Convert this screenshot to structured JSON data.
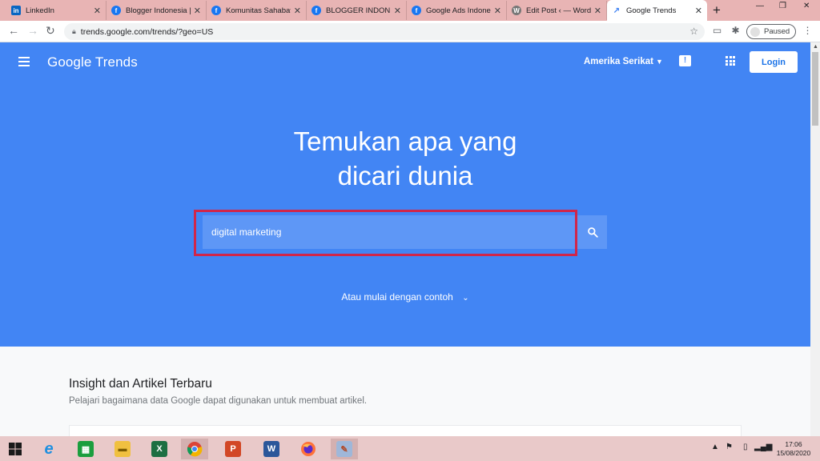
{
  "browser": {
    "tabs": [
      {
        "title": "LinkedIn",
        "favicon": "linkedin-icon"
      },
      {
        "title": "Blogger Indonesia |",
        "favicon": "facebook-icon"
      },
      {
        "title": "Komunitas Sahabat",
        "favicon": "facebook-icon"
      },
      {
        "title": "BLOGGER INDONE",
        "favicon": "facebook-icon"
      },
      {
        "title": "Google Ads Indone",
        "favicon": "facebook-icon"
      },
      {
        "title": "Edit Post ‹ — Word",
        "favicon": "wordpress-icon"
      },
      {
        "title": "Google Trends",
        "favicon": "trends-icon",
        "active": true
      }
    ],
    "url": "trends.google.com/trends/?geo=US",
    "profile_status": "Paused"
  },
  "header": {
    "logo": "Google Trends",
    "region": "Amerika Serikat",
    "login_label": "Login"
  },
  "hero": {
    "headline_line1": "Temukan apa yang",
    "headline_line2": "dicari dunia",
    "search_value": "digital marketing",
    "examples_label": "Atau mulai dengan contoh"
  },
  "insight": {
    "title": "Insight dan Artikel Terbaru",
    "subtitle": "Pelajari bagaimana data Google dapat digunakan untuk membuat artikel."
  },
  "taskbar": {
    "time": "17:06",
    "date": "15/08/2020"
  },
  "colors": {
    "hero_blue": "#4285f4",
    "search_field": "#5e97f6",
    "highlight_border": "#d0264a",
    "tab_strip": "#e8b4b4",
    "taskbar": "#e9c9c9"
  }
}
